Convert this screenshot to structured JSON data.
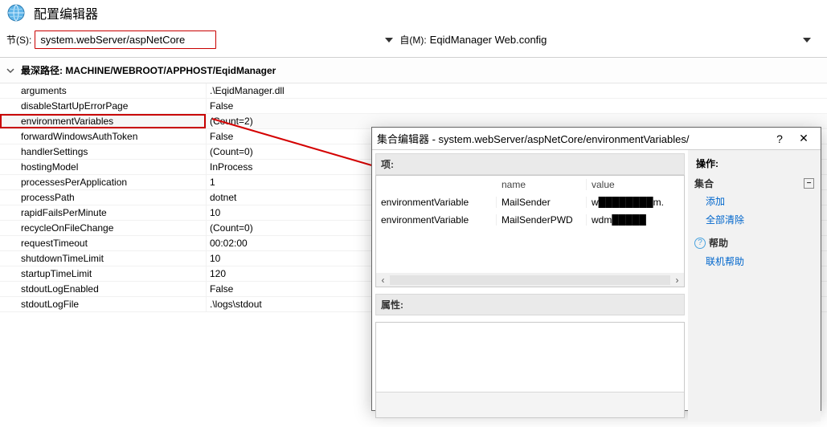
{
  "title": "配置编辑器",
  "toolbar": {
    "section_label": "节(S):",
    "section_value": "system.webServer/aspNetCore",
    "from_label": "自(M):",
    "from_value": "EqidManager Web.config"
  },
  "path_header": "最深路径: MACHINE/WEBROOT/APPHOST/EqidManager",
  "props": [
    {
      "key": "arguments",
      "val": ".\\EqidManager.dll"
    },
    {
      "key": "disableStartUpErrorPage",
      "val": "False"
    },
    {
      "key": "environmentVariables",
      "val": "(Count=2)",
      "highlight": true
    },
    {
      "key": "forwardWindowsAuthToken",
      "val": "False"
    },
    {
      "key": "handlerSettings",
      "val": "(Count=0)"
    },
    {
      "key": "hostingModel",
      "val": "InProcess"
    },
    {
      "key": "processesPerApplication",
      "val": "1"
    },
    {
      "key": "processPath",
      "val": "dotnet"
    },
    {
      "key": "rapidFailsPerMinute",
      "val": "10"
    },
    {
      "key": "recycleOnFileChange",
      "val": "(Count=0)"
    },
    {
      "key": "requestTimeout",
      "val": "00:02:00"
    },
    {
      "key": "shutdownTimeLimit",
      "val": "10"
    },
    {
      "key": "startupTimeLimit",
      "val": "120"
    },
    {
      "key": "stdoutLogEnabled",
      "val": "False"
    },
    {
      "key": "stdoutLogFile",
      "val": ".\\logs\\stdout"
    }
  ],
  "dialog": {
    "title": "集合编辑器 - system.webServer/aspNetCore/environmentVariables/",
    "items_header": "项:",
    "props_header": "属性:",
    "actions_header": "操作:",
    "group_label": "集合",
    "add": "添加",
    "clear": "全部清除",
    "help_group": "帮助",
    "help_link": "联机帮助",
    "cols": {
      "c1": "",
      "c2": "name",
      "c3": "value"
    },
    "rows": [
      {
        "c1": "environmentVariable",
        "c2": "MailSender",
        "c3": "w████████m."
      },
      {
        "c1": "environmentVariable",
        "c2": "MailSenderPWD",
        "c3": "wdm█████"
      }
    ]
  }
}
